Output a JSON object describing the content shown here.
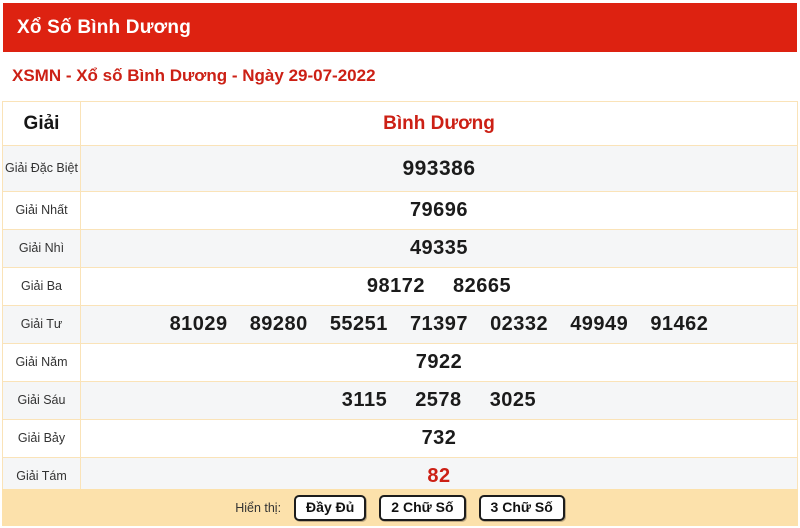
{
  "header": {
    "title": "Xổ Số Bình Dương",
    "bar_color": "#dd2211"
  },
  "subheading": {
    "text": "XSMN - Xổ số Bình Dương - Ngày 29-07-2022",
    "color": "#cc2015"
  },
  "table": {
    "head_label": "Giải",
    "head_value": "Bình Dương",
    "rows": [
      {
        "label": "Giải Đặc Biệt",
        "numbers": [
          "993386"
        ]
      },
      {
        "label": "Giải Nhất",
        "numbers": [
          "79696"
        ]
      },
      {
        "label": "Giải Nhì",
        "numbers": [
          "49335"
        ]
      },
      {
        "label": "Giải Ba",
        "numbers": [
          "98172",
          "82665"
        ]
      },
      {
        "label": "Giải Tư",
        "numbers": [
          "81029",
          "89280",
          "55251",
          "71397",
          "02332",
          "49949",
          "91462"
        ]
      },
      {
        "label": "Giải Năm",
        "numbers": [
          "7922"
        ]
      },
      {
        "label": "Giải Sáu",
        "numbers": [
          "3115",
          "2578",
          "3025"
        ]
      },
      {
        "label": "Giải Bảy",
        "numbers": [
          "732"
        ]
      },
      {
        "label": "Giải Tám",
        "numbers": [
          "82"
        ]
      }
    ]
  },
  "footer": {
    "label": "Hiển thị:",
    "buttons": [
      {
        "label": "Đầy Đủ"
      },
      {
        "label": "2 Chữ Số"
      },
      {
        "label": "3 Chữ Số"
      }
    ],
    "background": "#fce1ab"
  }
}
